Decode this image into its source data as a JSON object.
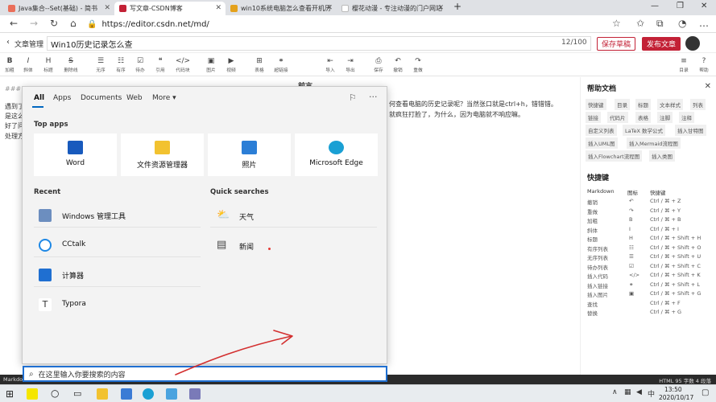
{
  "browser": {
    "tabs": [
      {
        "title": "Java集合--Set(基础) - 简书",
        "color": "#ea6f5a"
      },
      {
        "title": "写文章-CSDN博客",
        "color": "#c32136"
      },
      {
        "title": "win10系统电脑怎么查看开机历",
        "color": "#e4a11b"
      },
      {
        "title": "樱花动漫 - 专注动漫的门户网站",
        "color": "#ffffff"
      }
    ],
    "new_tab": "+",
    "url": "https://editor.csdn.net/md/"
  },
  "editor": {
    "back_label": "文章管理",
    "title": "Win10历史记录怎么查",
    "counter": "12/100",
    "save_draft": "保存草稿",
    "publish": "发布文章",
    "toolbar": [
      {
        "icon": "B",
        "label": "加粗"
      },
      {
        "icon": "I",
        "label": "斜体"
      },
      {
        "icon": "H",
        "label": "标题"
      },
      {
        "icon": "S",
        "label": "删除线"
      },
      {
        "icon": "☰",
        "label": "无序"
      },
      {
        "icon": "☷",
        "label": "有序"
      },
      {
        "icon": "☑",
        "label": "待办"
      },
      {
        "icon": "❝",
        "label": "引用"
      },
      {
        "icon": "</>",
        "label": "代码块"
      },
      {
        "icon": "▣",
        "label": "图片"
      },
      {
        "icon": "▶",
        "label": "视频"
      },
      {
        "icon": "⊞",
        "label": "表格"
      },
      {
        "icon": "⚭",
        "label": "超链接"
      },
      {
        "icon": "⇤",
        "label": "导入"
      },
      {
        "icon": "⇥",
        "label": "导出"
      },
      {
        "icon": "⎙",
        "label": "保存"
      },
      {
        "icon": "↶",
        "label": "撤销"
      },
      {
        "icon": "↷",
        "label": "重做"
      },
      {
        "icon": "≡",
        "label": "目录"
      },
      {
        "icon": "?",
        "label": "帮助"
      }
    ],
    "content_lines": [
      "###",
      "遇到了",
      "是这么",
      "好了问",
      "处理方"
    ],
    "preview_heading": "前言",
    "preview_line1": "何查看电脑的历史记录呢？当然张口就是ctrl+h，错错错。",
    "preview_line2": "就疯狂打脸了，为什么，因为电脑就不响应嘛。"
  },
  "help": {
    "title": "帮助文档",
    "chips": [
      "快捷键",
      "目录",
      "标题",
      "文本样式",
      "列表",
      "链接",
      "代码片",
      "表格",
      "注脚",
      "注释",
      "自定义列表",
      "LaTeX 数学公式",
      "插入甘特图",
      "插入UML图",
      "插入Mermaid流程图",
      "插入Flowchart流程图",
      "插入类图"
    ],
    "shortcut_title": "快捷键",
    "shortcut_headers": [
      "Markdown",
      "图标",
      "快捷键"
    ],
    "shortcuts": [
      [
        "撤销",
        "↶",
        "Ctrl / ⌘ + Z"
      ],
      [
        "重做",
        "↷",
        "Ctrl / ⌘ + Y"
      ],
      [
        "加粗",
        "B",
        "Ctrl / ⌘ + B"
      ],
      [
        "斜体",
        "I",
        "Ctrl / ⌘ + I"
      ],
      [
        "标题",
        "H",
        "Ctrl / ⌘ + Shift + H"
      ],
      [
        "有序列表",
        "☷",
        "Ctrl / ⌘ + Shift + O"
      ],
      [
        "无序列表",
        "☰",
        "Ctrl / ⌘ + Shift + U"
      ],
      [
        "待办列表",
        "☑",
        "Ctrl / ⌘ + Shift + C"
      ],
      [
        "插入代码",
        "</>",
        "Ctrl / ⌘ + Shift + K"
      ],
      [
        "插入链接",
        "⚭",
        "Ctrl / ⌘ + Shift + L"
      ],
      [
        "插入图片",
        "▣",
        "Ctrl / ⌘ + Shift + G"
      ],
      [
        "查找",
        "",
        "Ctrl / ⌘ + F"
      ],
      [
        "替换",
        "",
        "Ctrl / ⌘ + G"
      ]
    ]
  },
  "statusbar": {
    "left": "Markdown",
    "right": "HTML  95 字数  4 段落"
  },
  "search": {
    "filters": [
      "All",
      "Apps",
      "Documents",
      "Web",
      "More ▾"
    ],
    "top_apps_title": "Top apps",
    "top_apps": [
      {
        "label": "Word",
        "color": "#185abd"
      },
      {
        "label": "文件资源管理器",
        "color": "#f2c230"
      },
      {
        "label": "照片",
        "color": "#2b7ed6"
      },
      {
        "label": "Microsoft Edge",
        "color": "#1aa0d4"
      }
    ],
    "recent_title": "Recent",
    "recent": [
      {
        "label": "Windows 管理工具",
        "color": "#6c8ebf"
      },
      {
        "label": "CCtalk",
        "color": "#1e88e5"
      },
      {
        "label": "计算器",
        "color": "#1f6fd1"
      },
      {
        "label": "Typora",
        "color": "#ffffff"
      }
    ],
    "quick_title": "Quick searches",
    "quick": [
      {
        "label": "天气",
        "icon": "⛅"
      },
      {
        "label": "新闻",
        "icon": "▤"
      }
    ],
    "placeholder": "在这里输入你要搜索的内容"
  },
  "taskbar": {
    "time": "13:50",
    "date": "2020/10/17",
    "ime": "中"
  }
}
